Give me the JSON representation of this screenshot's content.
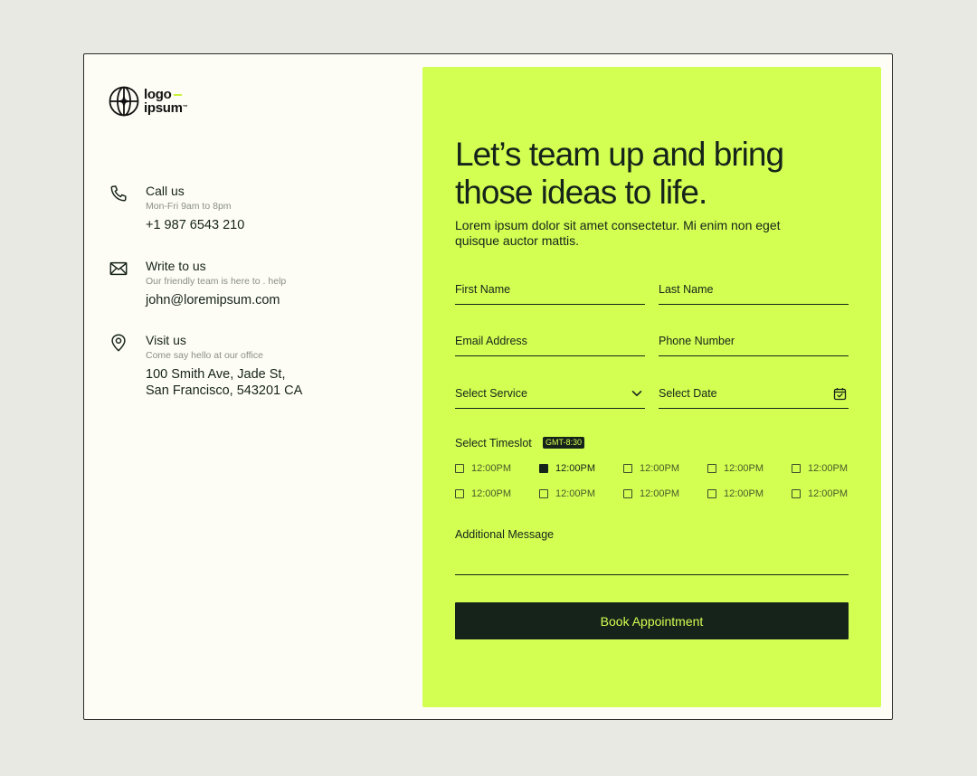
{
  "logo": {
    "line1": "logo",
    "line2": "ipsum",
    "trademark": "™"
  },
  "contacts": [
    {
      "icon": "phone-icon",
      "title": "Call us",
      "subtitle": "Mon-Fri 9am to 8pm",
      "value": "+1 987 6543 210"
    },
    {
      "icon": "mail-icon",
      "title": "Write to us",
      "subtitle": "Our friendly team is here to . help",
      "value": "john@loremipsum.com"
    },
    {
      "icon": "location-pin-icon",
      "title": "Visit us",
      "subtitle": "Come say hello at our office",
      "value": "100 Smith Ave, Jade St,\nSan Francisco, 543201 CA"
    }
  ],
  "form": {
    "headline": "Let’s team up and bring those ideas to life.",
    "lead": "Lorem ipsum dolor sit amet consectetur. Mi enim non eget quisque auctor mattis.",
    "fields": {
      "first_name": "First Name",
      "last_name": "Last Name",
      "email": "Email Address",
      "phone": "Phone Number",
      "service": "Select Service",
      "date": "Select Date"
    },
    "timeslot": {
      "label": "Select Timeslot",
      "timezone": "GMT-8:30",
      "slots": [
        {
          "label": "12:00PM",
          "checked": false
        },
        {
          "label": "12:00PM",
          "checked": true
        },
        {
          "label": "12:00PM",
          "checked": false
        },
        {
          "label": "12:00PM",
          "checked": false
        },
        {
          "label": "12:00PM",
          "checked": false
        },
        {
          "label": "12:00PM",
          "checked": false
        },
        {
          "label": "12:00PM",
          "checked": false
        },
        {
          "label": "12:00PM",
          "checked": false
        },
        {
          "label": "12:00PM",
          "checked": false
        },
        {
          "label": "12:00PM",
          "checked": false
        }
      ]
    },
    "message_label": "Additional Message",
    "submit_label": "Book Appointment"
  },
  "colors": {
    "accent": "#d2ff52",
    "dark": "#16231a",
    "page_bg": "#e9e9e3",
    "card_bg": "#fdfdf5"
  }
}
